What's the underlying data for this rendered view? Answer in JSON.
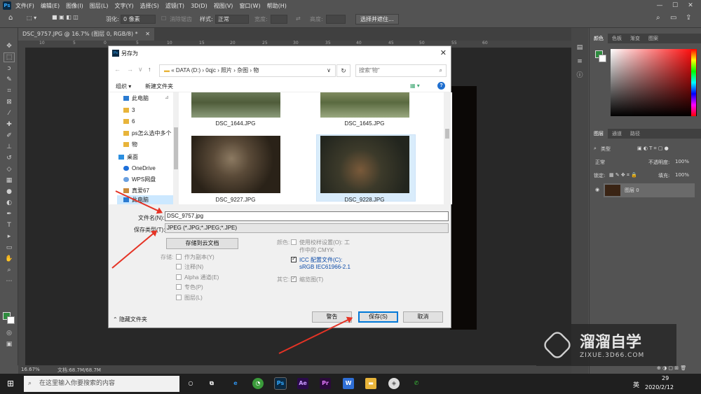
{
  "app": {
    "menus": [
      "文件(F)",
      "编辑(E)",
      "图像(I)",
      "图层(L)",
      "文字(Y)",
      "选择(S)",
      "滤镜(T)",
      "3D(D)",
      "视图(V)",
      "窗口(W)",
      "帮助(H)"
    ],
    "window_controls": [
      "—",
      "☐",
      "✕"
    ]
  },
  "options_bar": {
    "feather_label": "羽化:",
    "feather_value": "0 像素",
    "antialias_label": "消除锯齿",
    "style_label": "样式:",
    "style_value": "正常",
    "width_label": "宽度:",
    "height_label": "高度:",
    "select_mask_button": "选择并遮住..."
  },
  "document": {
    "tab_label": "DSC_9757.JPG @ 16.7% (图层 0, RGB/8) *",
    "zoom": "16.67%",
    "doc_size": "文档:68.7M/68.7M",
    "ruler_ticks": [
      "10",
      "5",
      "0",
      "5",
      "10",
      "15",
      "20",
      "25",
      "30",
      "35",
      "40",
      "45",
      "50",
      "55",
      "60"
    ]
  },
  "right_panel": {
    "color_tabs": [
      "颜色",
      "色板",
      "渐变",
      "图案"
    ],
    "layer_tabs": [
      "图层",
      "通道",
      "路径"
    ],
    "kind_filter": "类型",
    "blend_mode": "正常",
    "opacity_label": "不透明度:",
    "opacity_value": "100%",
    "lock_label": "锁定:",
    "fill_label": "填充:",
    "fill_value": "100%",
    "layer_name": "图层 0"
  },
  "dialog": {
    "title": "另存为",
    "breadcrumb": [
      "DATA (D:)",
      "0qjc",
      "照片",
      "杂图",
      "物"
    ],
    "search_placeholder": "搜索\"物\"",
    "organize_label": "组织 ▾",
    "new_folder_label": "新建文件夹",
    "nav_items": [
      "此电脑",
      "3",
      "6",
      "ps怎么选中多个",
      "物",
      "桌面",
      "OneDrive",
      "WPS网盘",
      "真爱67",
      "此电脑"
    ],
    "files": [
      {
        "name": "DSC_1644.JPG"
      },
      {
        "name": "DSC_1645.JPG"
      },
      {
        "name": "DSC_9227.JPG"
      },
      {
        "name": "DSC_9228.JPG"
      }
    ],
    "filename_label": "文件名(N):",
    "filename_value": "DSC_9757.jpg",
    "filetype_label": "保存类型(T):",
    "filetype_value": "JPEG (*.JPG;*.JPEG;*.JPE)",
    "cloud_button": "存储到云文档",
    "save_label": "存储:",
    "save_options": [
      "作为副本(Y)",
      "注释(N)",
      "Alpha 通道(E)",
      "专色(P)",
      "图层(L)"
    ],
    "color_label": "颜色:",
    "proof_setup": "使用校样设置(O): 工",
    "proof_setup_2": "作中的 CMYK",
    "icc_label": "ICC 配置文件(C):",
    "icc_value": "sRGB IEC61966-2.1",
    "other_label": "其它:",
    "thumbnail_label": "缩览图(T)",
    "hide_folders": "隐藏文件夹",
    "warning_button": "警告",
    "save_button": "保存(S)",
    "cancel_button": "取消"
  },
  "taskbar": {
    "search_placeholder": "在这里输入你要搜索的内容",
    "clock_date": "2020/2/12",
    "clock_time": "29",
    "ime": "英"
  },
  "watermark": {
    "brand": "溜溜自学",
    "url": "ZIXUE.3D66.COM"
  },
  "colors": {
    "ps_bg": "#535353",
    "dialog_bg": "#f0f0f0",
    "accent": "#0078d7",
    "annotation_arrow": "#e53325"
  }
}
